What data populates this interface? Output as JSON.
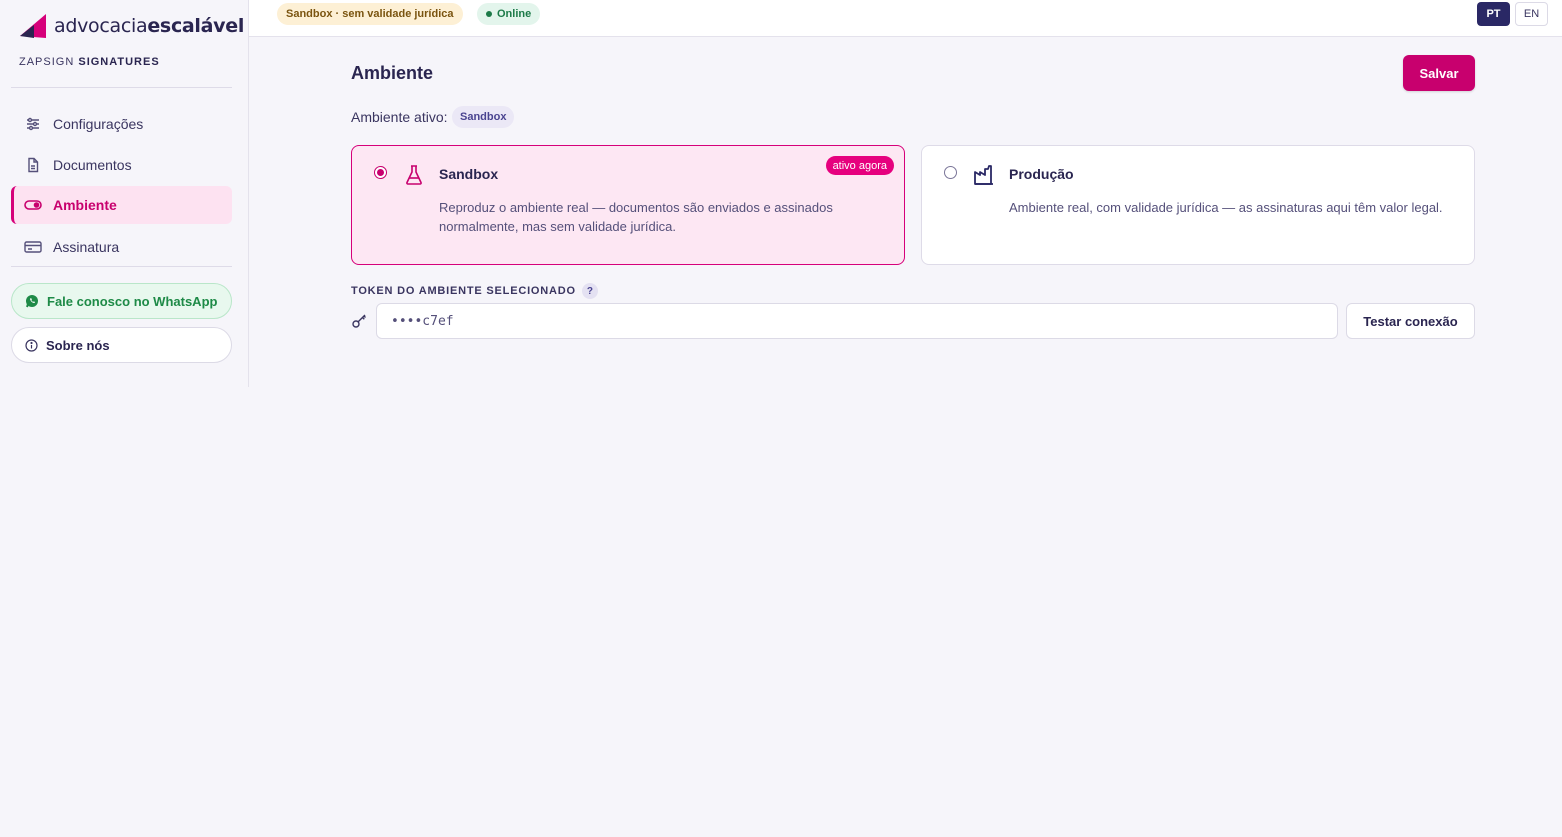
{
  "brand": {
    "name_light": "advocacia",
    "name_bold": "escalável",
    "subtitle_light": "ZAPSIGN",
    "subtitle_bold": "SIGNATURES",
    "accent": "#d6007a"
  },
  "sidebar": {
    "items": [
      {
        "label": "Configurações",
        "icon": "sliders-icon",
        "active": false
      },
      {
        "label": "Documentos",
        "icon": "document-icon",
        "active": false
      },
      {
        "label": "Ambiente",
        "icon": "toggle-icon",
        "active": true
      },
      {
        "label": "Assinatura",
        "icon": "card-icon",
        "active": false
      }
    ],
    "whatsapp_label": "Fale conosco no WhatsApp",
    "about_label": "Sobre nós"
  },
  "topbar": {
    "env_badge": "Sandbox · sem validade jurídica",
    "status_badge": "Online",
    "lang_pt": "PT",
    "lang_en": "EN"
  },
  "main": {
    "title": "Ambiente",
    "save_label": "Salvar",
    "active_label": "Ambiente ativo:",
    "active_value": "Sandbox",
    "environments": [
      {
        "title": "Sandbox",
        "description": "Reproduz o ambiente real — documentos são enviados e assinados normalmente, mas sem validade jurídica.",
        "badge": "ativo agora",
        "selected": true
      },
      {
        "title": "Produção",
        "description": "Ambiente real, com validade jurídica — as assinaturas aqui têm valor legal.",
        "selected": false
      }
    ],
    "token_label": "TOKEN DO AMBIENTE SELECIONADO",
    "token_help": "?",
    "token_value": "••••c7ef",
    "test_label": "Testar conexão"
  }
}
